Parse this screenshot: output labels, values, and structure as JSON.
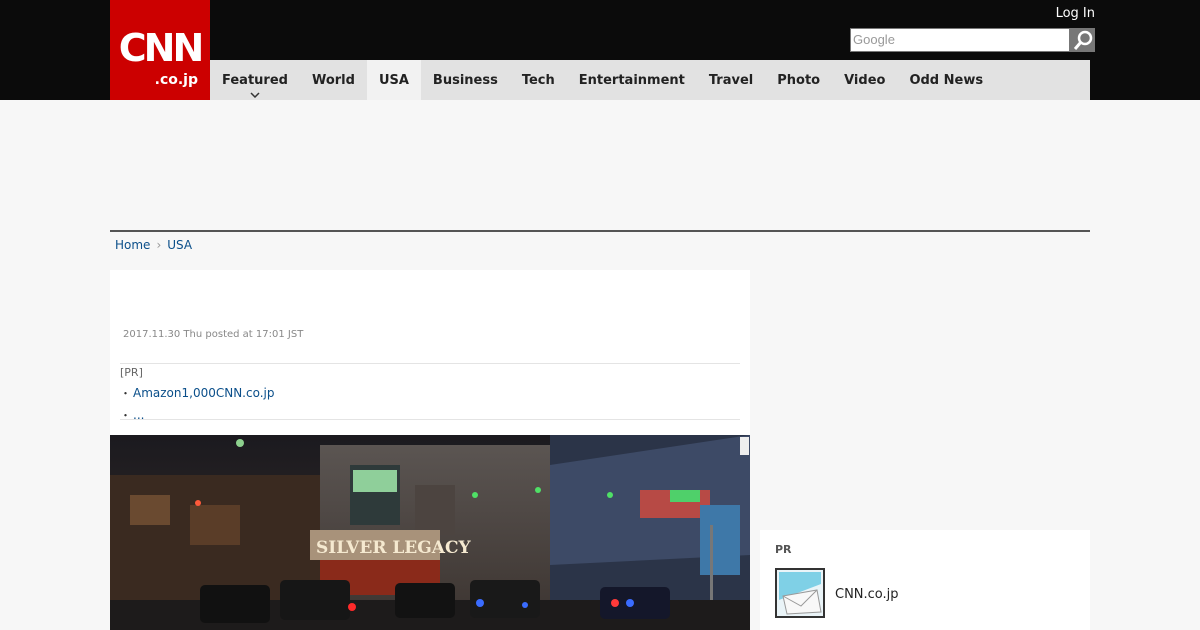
{
  "header": {
    "logo_main": "CNN",
    "logo_sub": ".co.jp",
    "login_label": "Log In",
    "search_placeholder": "Google"
  },
  "nav": {
    "items": [
      {
        "label": "Featured"
      },
      {
        "label": "World"
      },
      {
        "label": "USA"
      },
      {
        "label": "Business"
      },
      {
        "label": "Tech"
      },
      {
        "label": "Entertainment"
      },
      {
        "label": "Travel"
      },
      {
        "label": "Photo"
      },
      {
        "label": "Video"
      },
      {
        "label": "Odd News"
      }
    ],
    "active": "USA"
  },
  "breadcrumb": {
    "home": "Home",
    "current": "USA"
  },
  "article": {
    "date": "2017.11.30 Thu posted at 17:01 JST",
    "pr_label": "[PR]",
    "pr_links": [
      "Amazon1,000CNN.co.jp",
      "..."
    ],
    "photo_sign": "SILVER LEGACY"
  },
  "sidebar": {
    "pr_label": "PR",
    "item_text": "CNN.co.jp"
  },
  "colors": {
    "brand_red": "#cc0000",
    "topbar": "#0b0b0b",
    "nav_bg": "#e2e2e2",
    "link": "#0b4f8a"
  }
}
